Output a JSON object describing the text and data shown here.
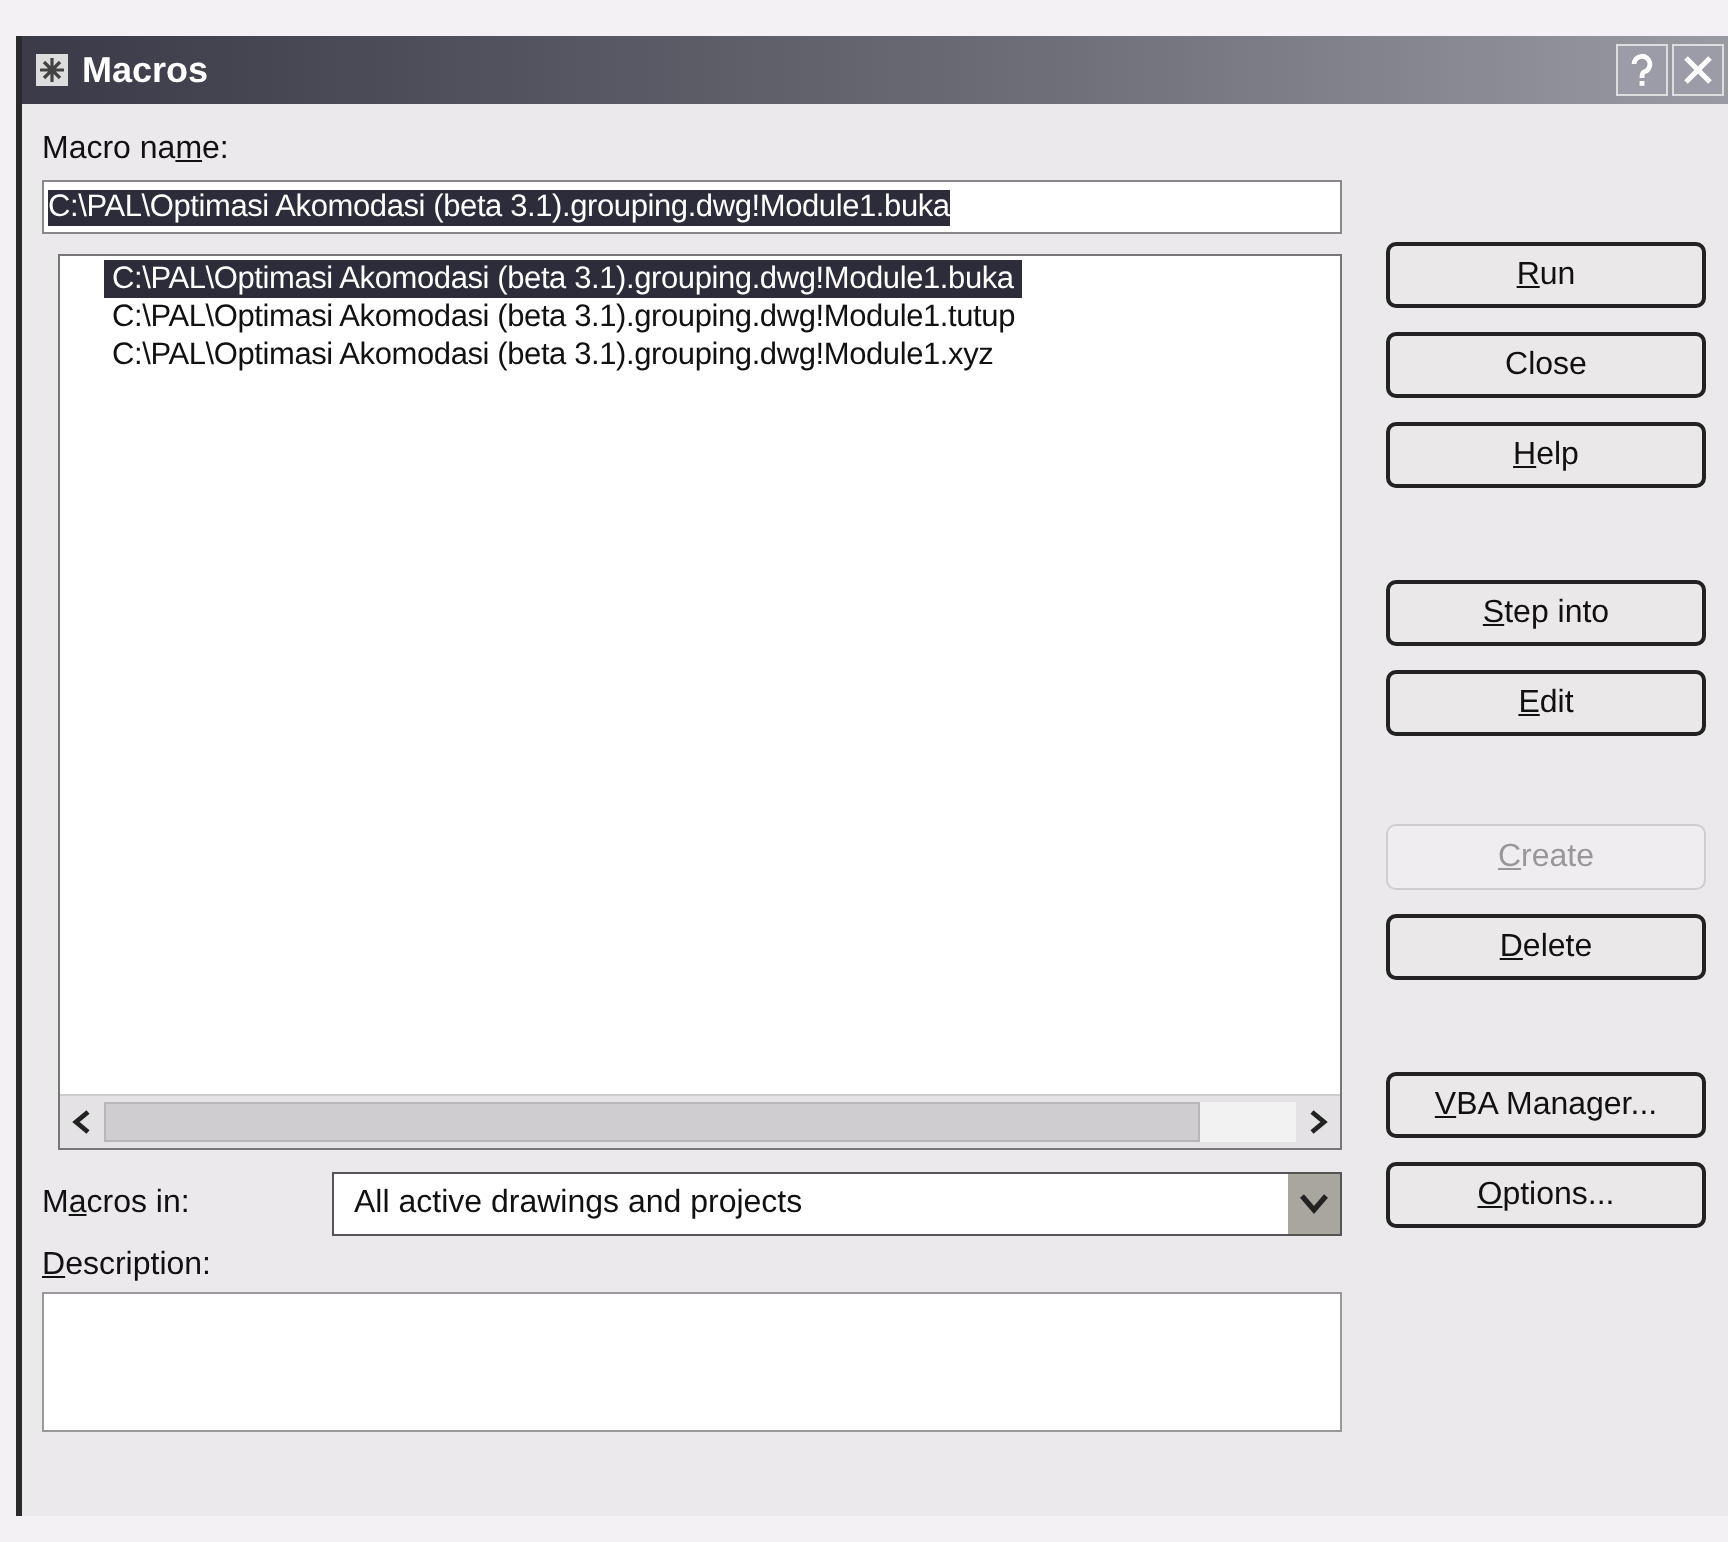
{
  "window": {
    "title": "Macros"
  },
  "macro_name": {
    "label": {
      "before": "Macro na",
      "key": "m",
      "after": "e:"
    },
    "value": "C:\\PAL\\Optimasi Akomodasi (beta 3.1).grouping.dwg!Module1.buka",
    "text_selected": true
  },
  "macro_list": {
    "items": [
      {
        "text": "C:\\PAL\\Optimasi Akomodasi (beta 3.1).grouping.dwg!Module1.buka",
        "selected": true
      },
      {
        "text": "C:\\PAL\\Optimasi Akomodasi (beta 3.1).grouping.dwg!Module1.tutup",
        "selected": false
      },
      {
        "text": "C:\\PAL\\Optimasi Akomodasi (beta 3.1).grouping.dwg!Module1.xyz",
        "selected": false
      }
    ]
  },
  "buttons": [
    {
      "label": {
        "key": "R",
        "after": "un"
      },
      "disabled": false
    },
    {
      "label": {
        "after": "Close"
      },
      "disabled": false
    },
    {
      "label": {
        "key": "H",
        "after": "elp"
      },
      "disabled": false
    },
    {
      "label": {
        "key": "S",
        "after": "tep into"
      },
      "disabled": false
    },
    {
      "label": {
        "key": "E",
        "after": "dit"
      },
      "disabled": false
    },
    {
      "label": {
        "key": "C",
        "after": "reate"
      },
      "disabled": true
    },
    {
      "label": {
        "key": "D",
        "after": "elete"
      },
      "disabled": false
    },
    {
      "label": {
        "key": "V",
        "after": "BA Manager..."
      },
      "disabled": false
    },
    {
      "label": {
        "key": "O",
        "after": "ptions..."
      },
      "disabled": false
    }
  ],
  "macros_in": {
    "label": {
      "before": "M",
      "key": "a",
      "after": "cros in:"
    },
    "value": "All active drawings and projects"
  },
  "description": {
    "label": {
      "key": "D",
      "after": "escription:"
    }
  }
}
